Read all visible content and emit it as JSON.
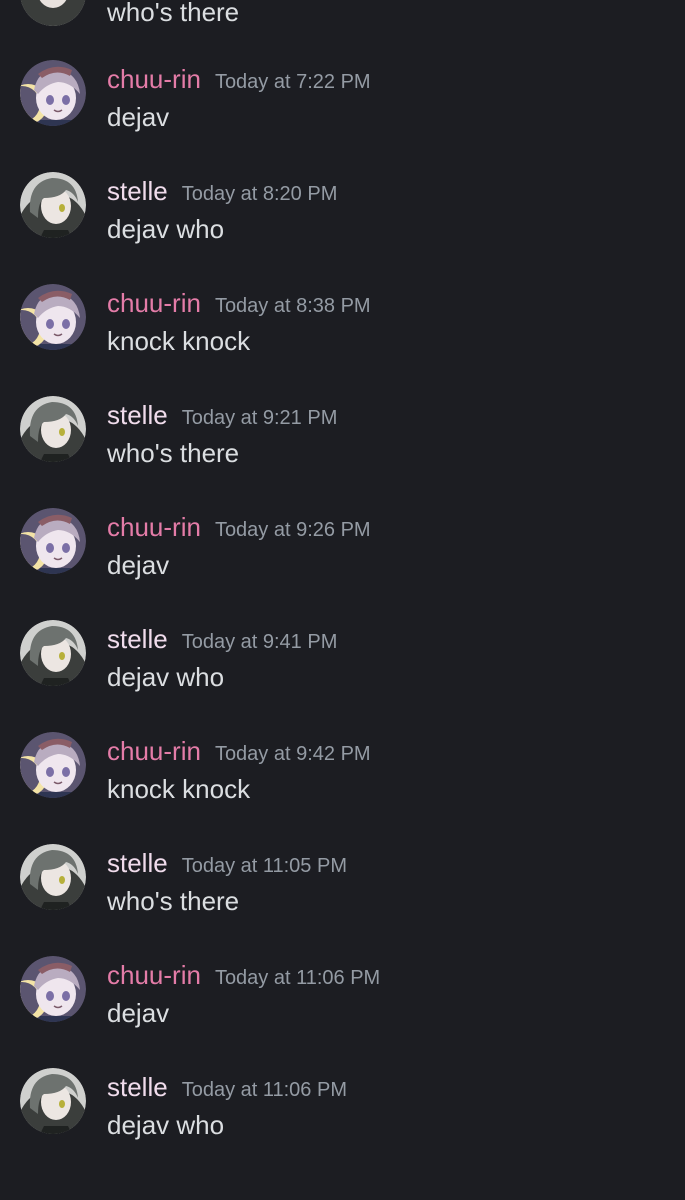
{
  "colors": {
    "background": "#1c1d22",
    "text": "#dbdee1",
    "timestamp": "#949ba4",
    "chuu_rin_name": "#e47ca8",
    "stelle_name": "#f0dcec"
  },
  "partial_message": {
    "text": "who's there",
    "avatar": "stelle-avatar-icon"
  },
  "messages": [
    {
      "author": "chuu-rin",
      "avatar": "chuu-rin-avatar-icon",
      "timestamp": "Today at 7:22 PM",
      "text": "dejav"
    },
    {
      "author": "stelle",
      "avatar": "stelle-avatar-icon",
      "timestamp": "Today at 8:20 PM",
      "text": "dejav who"
    },
    {
      "author": "chuu-rin",
      "avatar": "chuu-rin-avatar-icon",
      "timestamp": "Today at 8:38 PM",
      "text": "knock knock"
    },
    {
      "author": "stelle",
      "avatar": "stelle-avatar-icon",
      "timestamp": "Today at 9:21 PM",
      "text": "who's there"
    },
    {
      "author": "chuu-rin",
      "avatar": "chuu-rin-avatar-icon",
      "timestamp": "Today at 9:26 PM",
      "text": "dejav"
    },
    {
      "author": "stelle",
      "avatar": "stelle-avatar-icon",
      "timestamp": "Today at 9:41 PM",
      "text": "dejav who"
    },
    {
      "author": "chuu-rin",
      "avatar": "chuu-rin-avatar-icon",
      "timestamp": "Today at 9:42 PM",
      "text": "knock knock"
    },
    {
      "author": "stelle",
      "avatar": "stelle-avatar-icon",
      "timestamp": "Today at 11:05 PM",
      "text": "who's there"
    },
    {
      "author": "chuu-rin",
      "avatar": "chuu-rin-avatar-icon",
      "timestamp": "Today at 11:06 PM",
      "text": "dejav"
    },
    {
      "author": "stelle",
      "avatar": "stelle-avatar-icon",
      "timestamp": "Today at 11:06 PM",
      "text": "dejav who"
    }
  ]
}
